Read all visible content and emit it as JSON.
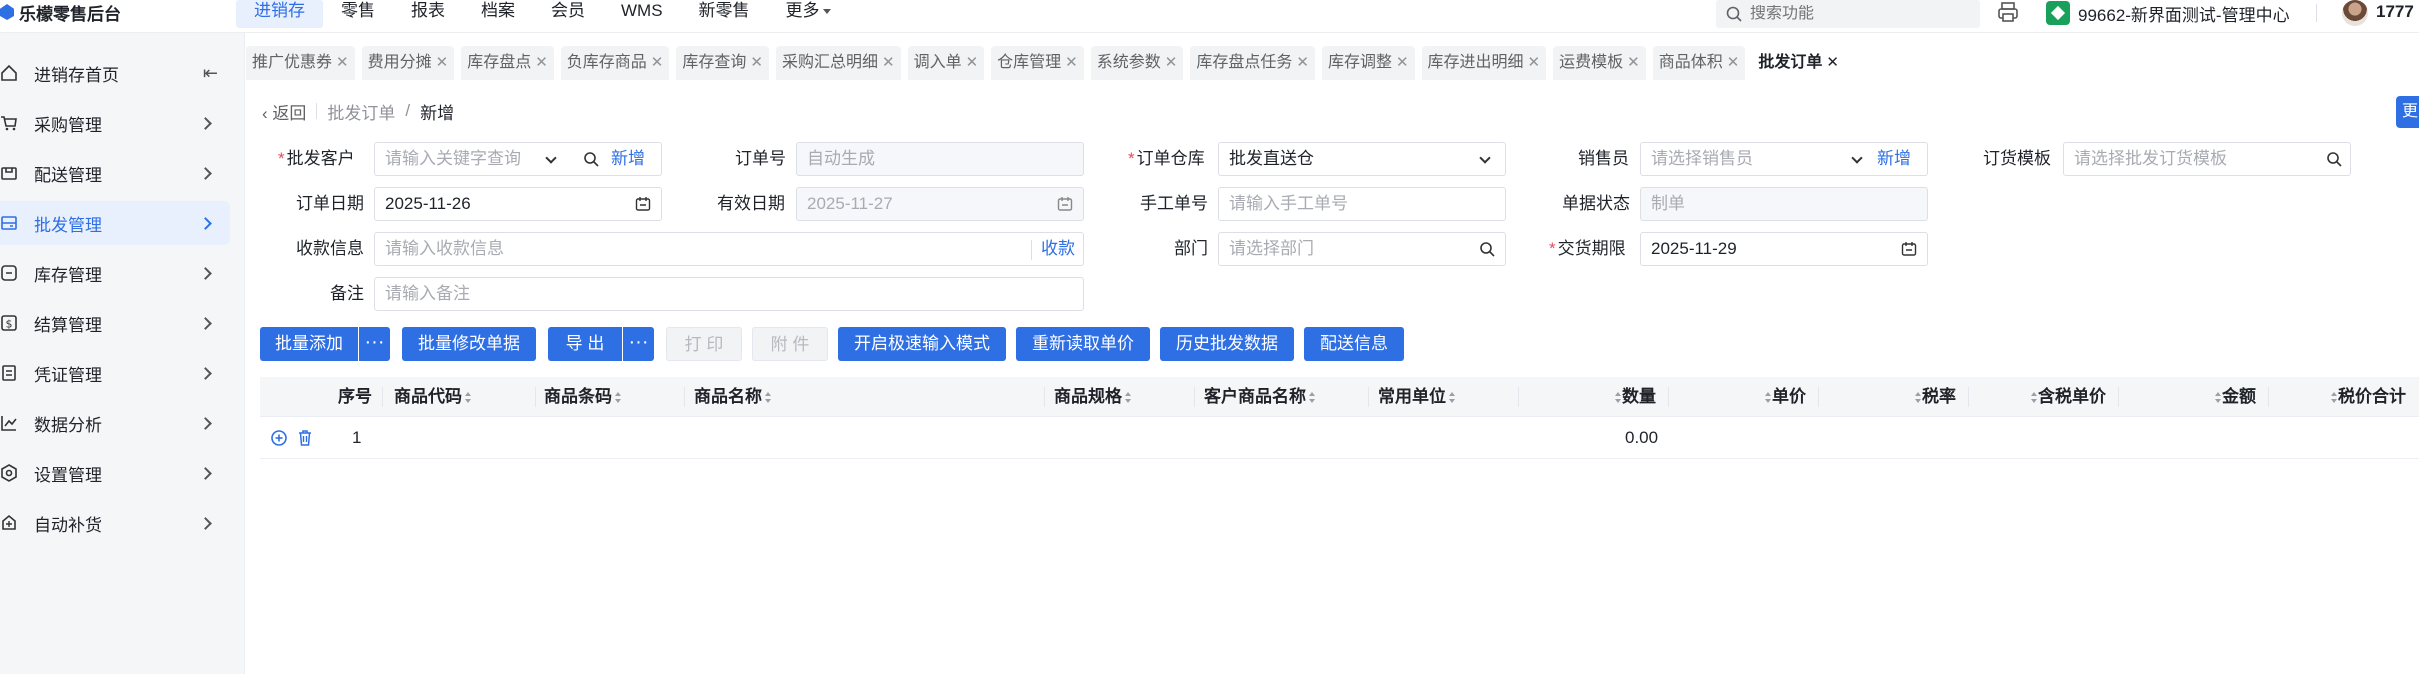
{
  "app": {
    "logo_text": "乐檬零售后台",
    "brand_color": "#2f6fe4"
  },
  "topnav": [
    {
      "label": "进销存",
      "active": true
    },
    {
      "label": "零售"
    },
    {
      "label": "报表"
    },
    {
      "label": "档案"
    },
    {
      "label": "会员"
    },
    {
      "label": "WMS"
    },
    {
      "label": "新零售"
    },
    {
      "label": "更多"
    }
  ],
  "header": {
    "search_placeholder": "搜索功能",
    "store_name": "99662-新界面测试-管理中心",
    "user_name": "1777"
  },
  "sidebar": {
    "items": [
      {
        "label": "进销存首页",
        "icon": "home-icon"
      },
      {
        "label": "采购管理",
        "icon": "cart-icon"
      },
      {
        "label": "配送管理",
        "icon": "delivery-icon"
      },
      {
        "label": "批发管理",
        "icon": "wholesale-icon",
        "active": true
      },
      {
        "label": "库存管理",
        "icon": "inventory-icon"
      },
      {
        "label": "结算管理",
        "icon": "settlement-icon"
      },
      {
        "label": "凭证管理",
        "icon": "voucher-icon"
      },
      {
        "label": "数据分析",
        "icon": "chart-icon"
      },
      {
        "label": "设置管理",
        "icon": "settings-icon"
      },
      {
        "label": "自动补货",
        "icon": "replenish-icon"
      }
    ]
  },
  "tabs": [
    {
      "label": "推广优惠券"
    },
    {
      "label": "费用分摊"
    },
    {
      "label": "库存盘点"
    },
    {
      "label": "负库存商品"
    },
    {
      "label": "库存查询"
    },
    {
      "label": "采购汇总明细"
    },
    {
      "label": "调入单"
    },
    {
      "label": "仓库管理"
    },
    {
      "label": "系统参数"
    },
    {
      "label": "库存盘点任务"
    },
    {
      "label": "库存调整"
    },
    {
      "label": "库存进出明细"
    },
    {
      "label": "运费模板"
    },
    {
      "label": "商品体积"
    },
    {
      "label": "批发订单",
      "active": true
    }
  ],
  "edge_button": {
    "label": "更"
  },
  "breadcrumb": {
    "back": "返回",
    "parent": "批发订单",
    "separator": "/",
    "current": "新增"
  },
  "form": {
    "customer": {
      "label": "批发客户",
      "placeholder": "请输入关键字查询",
      "add": "新增"
    },
    "order_no": {
      "label": "订单号",
      "placeholder": "自动生成"
    },
    "warehouse": {
      "label": "订单仓库",
      "value": "批发直送仓"
    },
    "salesperson": {
      "label": "销售员",
      "placeholder": "请选择销售员",
      "add": "新增"
    },
    "template": {
      "label": "订货模板",
      "placeholder": "请选择批发订货模板"
    },
    "order_date": {
      "label": "订单日期",
      "value": "2025-11-26"
    },
    "valid_date": {
      "label": "有效日期",
      "value": "2025-11-27"
    },
    "manual_no": {
      "label": "手工单号",
      "placeholder": "请输入手工单号"
    },
    "status": {
      "label": "单据状态",
      "value": "制单"
    },
    "payment": {
      "label": "收款信息",
      "placeholder": "请输入收款信息",
      "action": "收款"
    },
    "department": {
      "label": "部门",
      "placeholder": "请选择部门"
    },
    "delivery_deadline": {
      "label": "交货期限",
      "value": "2025-11-29"
    },
    "remark": {
      "label": "备注",
      "placeholder": "请输入备注"
    }
  },
  "actions": {
    "batch_add": "批量添加",
    "batch_modify": "批量修改单据",
    "export": "导 出",
    "print": "打 印",
    "attachment": "附 件",
    "fast_input": "开启极速输入模式",
    "reread_price": "重新读取单价",
    "history": "历史批发数据",
    "delivery_info": "配送信息",
    "more": "···"
  },
  "table": {
    "columns": [
      "序号",
      "商品代码",
      "商品条码",
      "商品名称",
      "商品规格",
      "客户商品名称",
      "常用单位",
      "数量",
      "单价",
      "税率",
      "含税单价",
      "金额",
      "税价合计"
    ],
    "rows": [
      {
        "index": "1",
        "quantity": "0.00"
      }
    ]
  }
}
